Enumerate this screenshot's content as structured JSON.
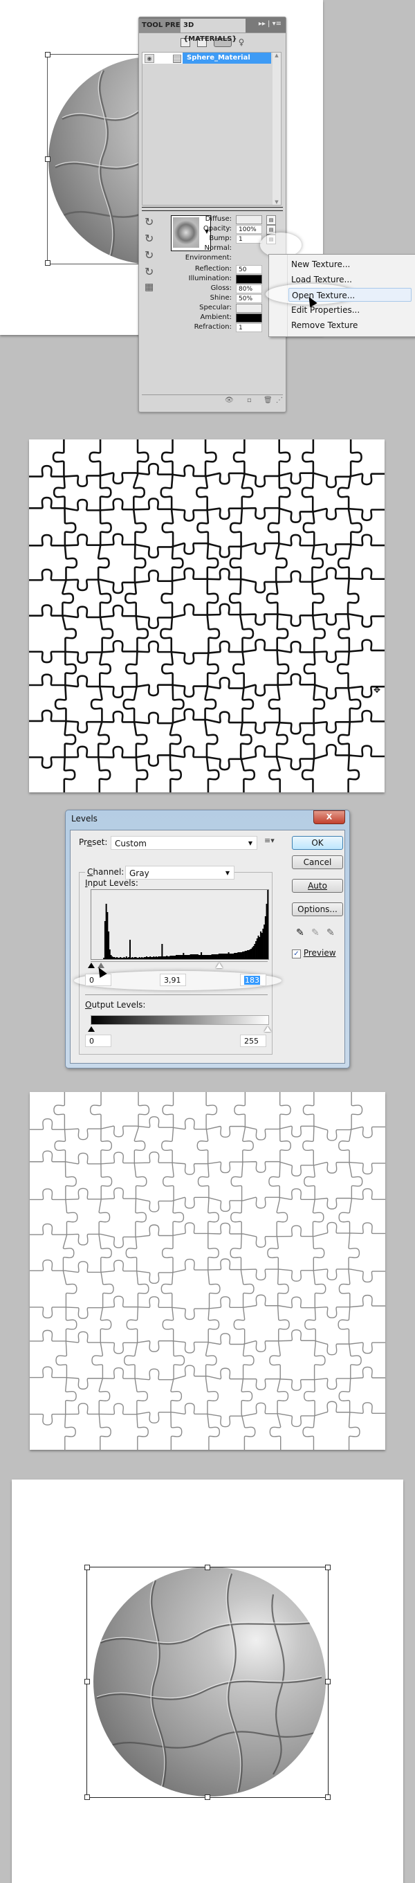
{
  "panel": {
    "tabs": [
      {
        "label": "TOOL PRE",
        "active": false
      },
      {
        "label": "3D {MATERIALS}",
        "active": true
      }
    ],
    "layers": [
      {
        "name": "Sphere_Material",
        "selected": true
      }
    ],
    "properties": [
      {
        "label": "Diffuse:",
        "value": "",
        "kind": "swatch-light",
        "has_texture_button": true
      },
      {
        "label": "Opacity:",
        "value": "100%",
        "kind": "field",
        "has_texture_button": true
      },
      {
        "label": "Bump:",
        "value": "1",
        "kind": "field",
        "has_texture_button": true
      },
      {
        "label": "Normal:",
        "value": null,
        "kind": "label-only"
      },
      {
        "label": "Environment:",
        "value": null,
        "kind": "label-only"
      },
      {
        "label": "Reflection:",
        "value": "50",
        "kind": "field"
      },
      {
        "label": "Illumination:",
        "value": "",
        "kind": "swatch-black"
      },
      {
        "label": "Gloss:",
        "value": "80%",
        "kind": "field"
      },
      {
        "label": "Shine:",
        "value": "50%",
        "kind": "field"
      },
      {
        "label": "Specular:",
        "value": "",
        "kind": "swatch-light"
      },
      {
        "label": "Ambient:",
        "value": "",
        "kind": "swatch-black"
      },
      {
        "label": "Refraction:",
        "value": "1",
        "kind": "field"
      }
    ]
  },
  "context_menu": {
    "items": [
      {
        "label": "New Texture...",
        "highlighted": false
      },
      {
        "label": "Load Texture...",
        "highlighted": false
      },
      {
        "label": "Open Texture...",
        "highlighted": true
      },
      {
        "label": "Edit Properties...",
        "highlighted": false
      },
      {
        "label": "Remove Texture",
        "highlighted": false
      }
    ]
  },
  "levels": {
    "title": "Levels",
    "close_label": "X",
    "preset_label_pre": "Pr",
    "preset_label_u": "e",
    "preset_label_post": "set:",
    "preset_value": "Custom",
    "channel_label_u": "C",
    "channel_label_post": "hannel:",
    "channel_value": "Gray",
    "input_levels_u": "I",
    "input_levels_post": "nput Levels:",
    "input_black": "0",
    "input_gamma": "3,91",
    "input_white": "183",
    "output_levels_u": "O",
    "output_levels_post": "utput Levels:",
    "output_black": "0",
    "output_white": "255",
    "buttons": {
      "ok": "OK",
      "cancel": "Cancel",
      "auto": "Auto",
      "options": "Options..."
    },
    "preview_label": "Preview",
    "preview_checked": true,
    "histogram_levels": [
      0,
      0,
      0,
      0,
      0,
      0,
      0,
      0,
      0,
      0,
      2,
      55,
      80,
      68,
      40,
      14,
      6,
      4,
      3,
      3,
      2,
      3,
      2,
      2,
      3,
      2,
      2,
      3,
      2,
      4,
      2,
      3,
      28,
      2,
      3,
      2,
      3,
      3,
      2,
      2,
      3,
      2,
      3,
      2,
      3,
      3,
      4,
      3,
      3,
      4,
      3,
      3,
      4,
      3,
      4,
      3,
      4,
      4,
      4,
      22,
      4,
      4,
      4,
      5,
      4,
      4,
      5,
      5,
      5,
      5,
      5,
      6,
      6,
      6,
      6,
      6,
      6,
      9,
      6,
      6,
      6,
      6,
      6,
      7,
      7,
      7,
      7,
      7,
      7,
      7,
      6,
      6,
      10,
      6,
      6,
      6,
      6,
      6,
      6,
      6,
      6,
      7,
      7,
      7,
      7,
      7,
      7,
      8,
      8,
      8,
      8,
      8,
      8,
      8,
      8,
      10,
      8,
      8,
      8,
      8,
      9,
      9,
      9,
      10,
      10,
      10,
      10,
      11,
      11,
      12,
      12,
      13,
      13,
      14,
      15,
      17,
      19,
      22,
      26,
      30,
      34,
      32,
      40,
      38,
      44,
      50,
      62,
      80,
      100
    ]
  },
  "canvases": {
    "puzzle_rows": 10,
    "puzzle_cols": 10
  }
}
